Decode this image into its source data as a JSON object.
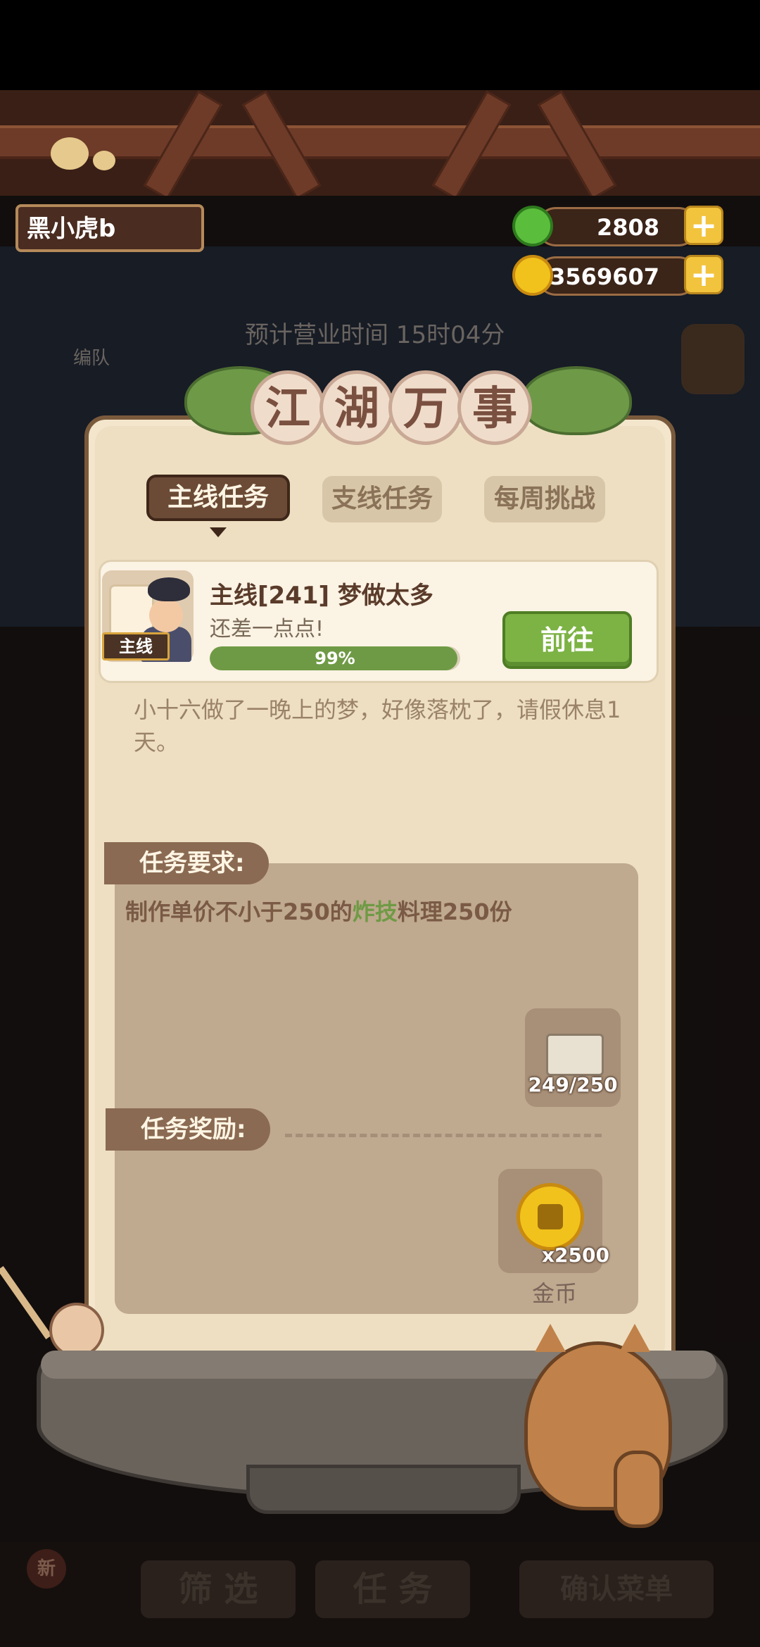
{
  "player": {
    "name": "黑小虎b"
  },
  "resources": {
    "jade": {
      "value": "2808",
      "color": "#5bbd3c"
    },
    "coins": {
      "value": "3569607",
      "color": "#f2c21c"
    }
  },
  "background": {
    "team_label": "编队",
    "business_time": "预计营业时间  15时04分",
    "bottom_new": "新",
    "filter_label": "筛 选",
    "task_label": "任 务",
    "confirm_label": "确认菜单"
  },
  "panel": {
    "title_chars": [
      "江",
      "湖",
      "万",
      "事"
    ],
    "tabs": [
      {
        "label": "主线任务",
        "active": true
      },
      {
        "label": "支线任务",
        "active": false
      },
      {
        "label": "每周挑战",
        "active": false
      }
    ],
    "quest": {
      "tag": "主线",
      "title": "主线[241]  梦做太多",
      "subtitle": "还差一点点!",
      "progress": 0.99,
      "progress_text": "99%",
      "go_button": "前往",
      "description": "小十六做了一晚上的梦，好像落枕了，请假休息1天。"
    },
    "requirements": {
      "label": "任务要求:",
      "text_prefix": "制作单价不小于250的",
      "text_highlight": "炸技",
      "text_suffix": "料理250份",
      "item_count": "249/250"
    },
    "rewards": {
      "label": "任务奖励:",
      "coin_amount": "x2500",
      "coin_name": "金币"
    }
  }
}
